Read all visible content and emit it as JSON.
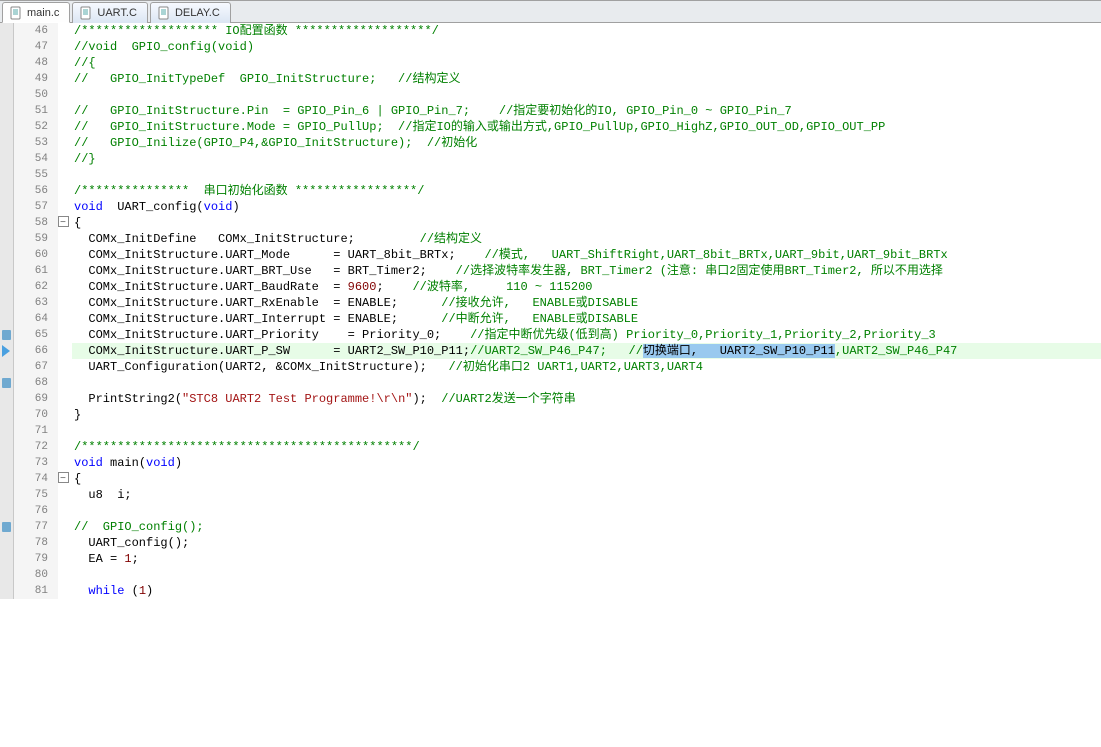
{
  "tabs": [
    {
      "name": "main.c",
      "active": true
    },
    {
      "name": "UART.C",
      "active": false
    },
    {
      "name": "DELAY.C",
      "active": false
    }
  ],
  "first_line": 46,
  "lines": [
    {
      "n": 46,
      "tokens": [
        [
          "c-comment",
          "/******************* IO配置函数 *******************/"
        ]
      ]
    },
    {
      "n": 47,
      "tokens": [
        [
          "c-comment",
          "//void  GPIO_config(void)"
        ]
      ]
    },
    {
      "n": 48,
      "tokens": [
        [
          "c-comment",
          "//{"
        ]
      ]
    },
    {
      "n": 49,
      "tokens": [
        [
          "c-comment",
          "//   GPIO_InitTypeDef  GPIO_InitStructure;   //结构定义"
        ]
      ]
    },
    {
      "n": 50,
      "tokens": []
    },
    {
      "n": 51,
      "tokens": [
        [
          "c-comment",
          "//   GPIO_InitStructure.Pin  = GPIO_Pin_6 | GPIO_Pin_7;    //指定要初始化的IO, GPIO_Pin_0 ~ GPIO_Pin_7"
        ]
      ]
    },
    {
      "n": 52,
      "tokens": [
        [
          "c-comment",
          "//   GPIO_InitStructure.Mode = GPIO_PullUp;  //指定IO的输入或输出方式,GPIO_PullUp,GPIO_HighZ,GPIO_OUT_OD,GPIO_OUT_PP"
        ]
      ]
    },
    {
      "n": 53,
      "tokens": [
        [
          "c-comment",
          "//   GPIO_Inilize(GPIO_P4,&GPIO_InitStructure);  //初始化"
        ]
      ]
    },
    {
      "n": 54,
      "tokens": [
        [
          "c-comment",
          "//}"
        ]
      ]
    },
    {
      "n": 55,
      "tokens": []
    },
    {
      "n": 56,
      "tokens": [
        [
          "c-comment",
          "/***************  串口初始化函数 *****************/"
        ]
      ]
    },
    {
      "n": 57,
      "tokens": [
        [
          "c-keyword",
          "void"
        ],
        [
          "c-text",
          "  UART_config("
        ],
        [
          "c-keyword",
          "void"
        ],
        [
          "c-text",
          ")"
        ]
      ]
    },
    {
      "n": 58,
      "fold": true,
      "tokens": [
        [
          "c-text",
          "{"
        ]
      ]
    },
    {
      "n": 59,
      "tokens": [
        [
          "c-text",
          "  COMx_InitDefine   COMx_InitStructure;         "
        ],
        [
          "c-comment",
          "//结构定义"
        ]
      ]
    },
    {
      "n": 60,
      "tokens": [
        [
          "c-text",
          "  COMx_InitStructure.UART_Mode      = UART_8bit_BRTx;    "
        ],
        [
          "c-comment",
          "//模式,   UART_ShiftRight,UART_8bit_BRTx,UART_9bit,UART_9bit_BRTx"
        ]
      ]
    },
    {
      "n": 61,
      "tokens": [
        [
          "c-text",
          "  COMx_InitStructure.UART_BRT_Use   = BRT_Timer2;    "
        ],
        [
          "c-comment",
          "//选择波特率发生器, BRT_Timer2 (注意: 串口2固定使用BRT_Timer2, 所以不用选择"
        ]
      ]
    },
    {
      "n": 62,
      "tokens": [
        [
          "c-text",
          "  COMx_InitStructure.UART_BaudRate  = "
        ],
        [
          "c-number",
          "9600"
        ],
        [
          "c-text",
          ";    "
        ],
        [
          "c-comment",
          "//波特率,     110 ~ 115200"
        ]
      ]
    },
    {
      "n": 63,
      "tokens": [
        [
          "c-text",
          "  COMx_InitStructure.UART_RxEnable  = ENABLE;      "
        ],
        [
          "c-comment",
          "//接收允许,   ENABLE或DISABLE"
        ]
      ]
    },
    {
      "n": 64,
      "tokens": [
        [
          "c-text",
          "  COMx_InitStructure.UART_Interrupt = ENABLE;      "
        ],
        [
          "c-comment",
          "//中断允许,   ENABLE或DISABLE"
        ]
      ]
    },
    {
      "n": 65,
      "mark": true,
      "tokens": [
        [
          "c-text",
          "  COMx_InitStructure.UART_Priority    = Priority_0;    "
        ],
        [
          "c-comment",
          "//指定中断优先级(低到高) Priority_0,Priority_1,Priority_2,Priority_3"
        ]
      ]
    },
    {
      "n": 66,
      "arrow": true,
      "highlight": true,
      "tokens": [
        [
          "c-text",
          "  COMx_InitStructure.UART_P_SW      = UART2_SW_P10_P11;"
        ],
        [
          "c-comment",
          "//UART2_SW_P46_P47;   //"
        ],
        [
          "c-selbg",
          "切换端口,   UART2_SW_P10_P11"
        ],
        [
          "c-comment",
          ",UART2_SW_P46_P47"
        ]
      ]
    },
    {
      "n": 67,
      "tokens": [
        [
          "c-text",
          "  UART_Configuration(UART2, &COMx_InitStructure);   "
        ],
        [
          "c-comment",
          "//初始化串口2 UART1,UART2,UART3,UART4"
        ]
      ]
    },
    {
      "n": 68,
      "mark": true,
      "tokens": []
    },
    {
      "n": 69,
      "tokens": [
        [
          "c-text",
          "  PrintString2("
        ],
        [
          "c-string",
          "\"STC8 UART2 Test Programme!\\r\\n\""
        ],
        [
          "c-text",
          ");  "
        ],
        [
          "c-comment",
          "//UART2发送一个字符串"
        ]
      ]
    },
    {
      "n": 70,
      "tokens": [
        [
          "c-text",
          "}"
        ]
      ]
    },
    {
      "n": 71,
      "tokens": []
    },
    {
      "n": 72,
      "tokens": [
        [
          "c-comment",
          "/**********************************************/"
        ]
      ]
    },
    {
      "n": 73,
      "tokens": [
        [
          "c-keyword",
          "void"
        ],
        [
          "c-text",
          " main("
        ],
        [
          "c-keyword",
          "void"
        ],
        [
          "c-text",
          ")"
        ]
      ]
    },
    {
      "n": 74,
      "fold": true,
      "tokens": [
        [
          "c-text",
          "{"
        ]
      ]
    },
    {
      "n": 75,
      "tokens": [
        [
          "c-text",
          "  u8  i;"
        ]
      ]
    },
    {
      "n": 76,
      "tokens": []
    },
    {
      "n": 77,
      "mark": true,
      "tokens": [
        [
          "c-comment",
          "//  GPIO_config();"
        ]
      ]
    },
    {
      "n": 78,
      "tokens": [
        [
          "c-text",
          "  UART_config();"
        ]
      ]
    },
    {
      "n": 79,
      "tokens": [
        [
          "c-text",
          "  EA = "
        ],
        [
          "c-number",
          "1"
        ],
        [
          "c-text",
          ";"
        ]
      ]
    },
    {
      "n": 80,
      "tokens": []
    },
    {
      "n": 81,
      "tokens": [
        [
          "c-text",
          "  "
        ],
        [
          "c-keyword",
          "while"
        ],
        [
          "c-text",
          " ("
        ],
        [
          "c-number",
          "1"
        ],
        [
          "c-text",
          ")"
        ]
      ]
    }
  ]
}
